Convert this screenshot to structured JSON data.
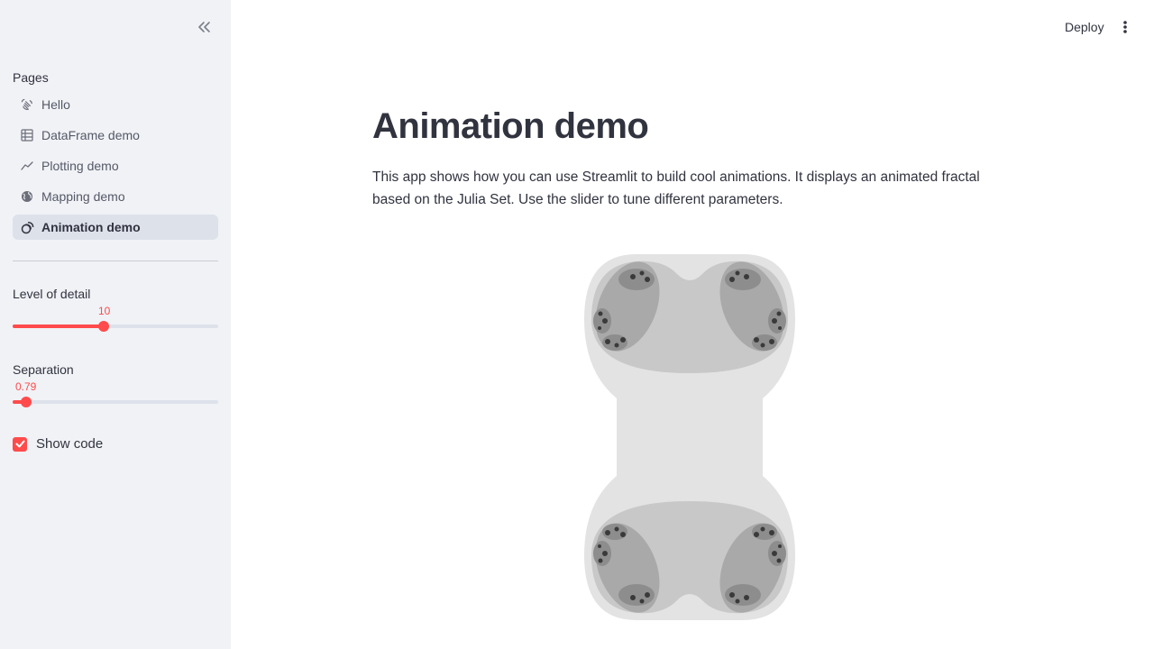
{
  "sidebar": {
    "pages_label": "Pages",
    "items": [
      {
        "label": "Hello",
        "icon": "hand-wave-icon",
        "active": false
      },
      {
        "label": "DataFrame demo",
        "icon": "table-icon",
        "active": false
      },
      {
        "label": "Plotting demo",
        "icon": "chart-line-icon",
        "active": false
      },
      {
        "label": "Mapping demo",
        "icon": "globe-icon",
        "active": false
      },
      {
        "label": "Animation demo",
        "icon": "animation-icon",
        "active": true
      }
    ],
    "level_of_detail": {
      "label": "Level of detail",
      "value": "10",
      "fraction": 0.45
    },
    "separation": {
      "label": "Separation",
      "value": "0.79",
      "fraction": 0.07
    },
    "show_code": {
      "label": "Show code",
      "checked": true
    }
  },
  "header": {
    "deploy_label": "Deploy"
  },
  "main": {
    "title": "Animation demo",
    "description": "This app shows how you can use Streamlit to build cool animations. It displays an animated fractal based on the Julia Set. Use the slider to tune different parameters."
  },
  "colors": {
    "accent": "#ff4b4b",
    "sidebar_bg": "#f0f2f6",
    "active_item_bg": "#dde1ea",
    "text": "#31333f"
  }
}
